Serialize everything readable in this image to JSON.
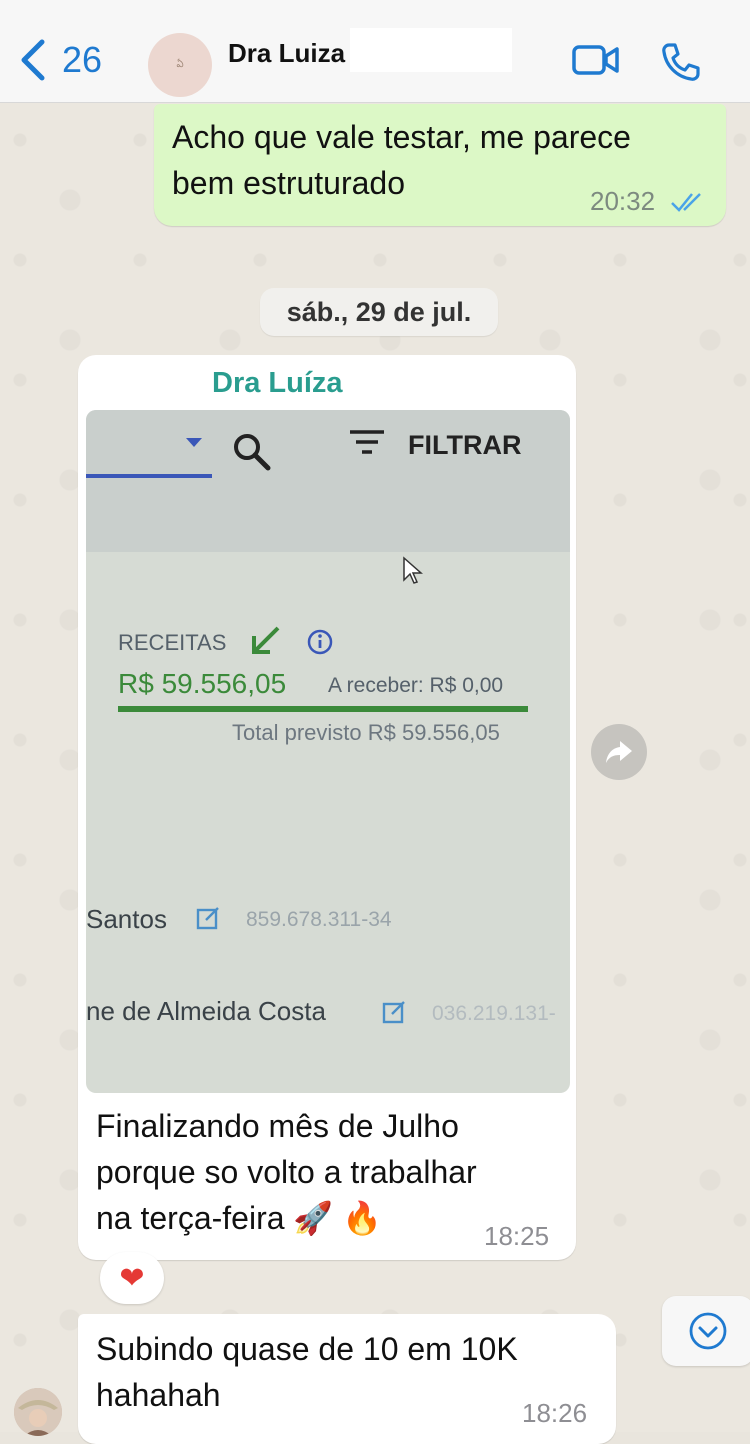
{
  "header": {
    "back_count": "26",
    "contact_name": "Dra Luiza",
    "icons": [
      "chevron-left-icon",
      "video-call-icon",
      "phone-icon"
    ]
  },
  "messages": {
    "m1": {
      "text_line1": "Acho que vale testar, me parece",
      "text_line2": "bem estruturado",
      "time": "20:32"
    },
    "date_separator": "sáb., 29 de jul.",
    "m2": {
      "sender": "Dra Luíza",
      "image": {
        "filter_label": "FILTRAR",
        "receitas_label": "RECEITAS",
        "receitas_value": "R$  59.556,05",
        "a_receber": "A receber: R$  0,00",
        "total_previsto": "Total previsto R$  59.556,05",
        "row1_name": "Santos",
        "row1_doc": "859.678.311-34",
        "row2_name": "ne de Almeida Costa",
        "row2_doc": "036.219.131-"
      },
      "text_line1": "Finalizando mês de Julho",
      "text_line2": "porque so volto a trabalhar",
      "text_line3": "na terça-feira 🚀  🔥",
      "time": "18:25",
      "reaction": "❤️"
    },
    "m3": {
      "text_line1": "Subindo quase de 10 em 10K",
      "text_line2": "hahahah",
      "time": "18:26"
    }
  },
  "colors": {
    "accent_blue": "#1f7ad0",
    "outgoing_bubble": "#dcf8c6",
    "sender_name": "#2a9d8f",
    "receitas_green": "#3b8a3a"
  }
}
